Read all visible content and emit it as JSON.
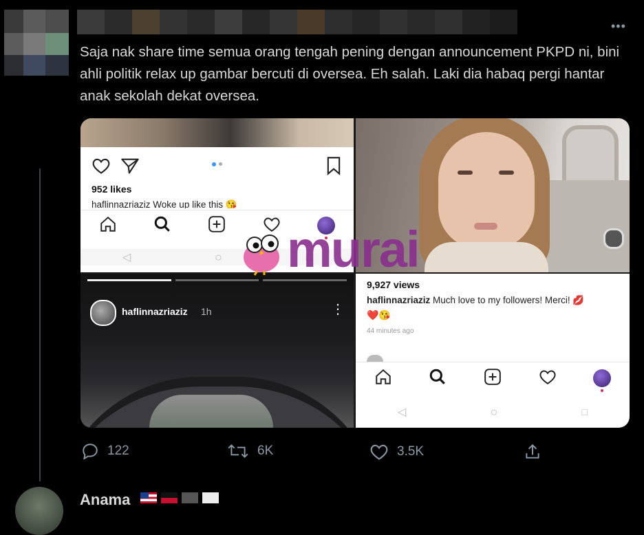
{
  "tweet": {
    "text": "Saja nak share time semua orang tengah pening dengan announcement PKPD ni, bini ahli politik relax up gambar bercuti di oversea. Eh salah. Laki dia habaq pergi hantar anak sekolah dekat oversea.",
    "more_icon": "more-horizontal-icon"
  },
  "media": {
    "top_left": {
      "likes": "952 likes",
      "caption": "haflinnazriaziz Woke up like this 😘"
    },
    "bottom_left": {
      "username": "haflinnazriaziz",
      "time": "1h"
    },
    "bottom_right": {
      "views": "9,927 views",
      "username": "haflinnazriaziz",
      "caption": " Much love to my followers! Merci! 💋",
      "emoji_line": "❤️😘",
      "time": "44 minutes ago"
    },
    "watermark": "murai"
  },
  "actions": {
    "reply_count": "122",
    "retweet_count": "6K",
    "like_count": "3.5K"
  },
  "next_tweet": {
    "name": "Anama"
  },
  "colors": {
    "background": "#000000",
    "text": "#d9d9d9",
    "muted": "#8b98a5",
    "watermark": "#8a2e8f"
  }
}
